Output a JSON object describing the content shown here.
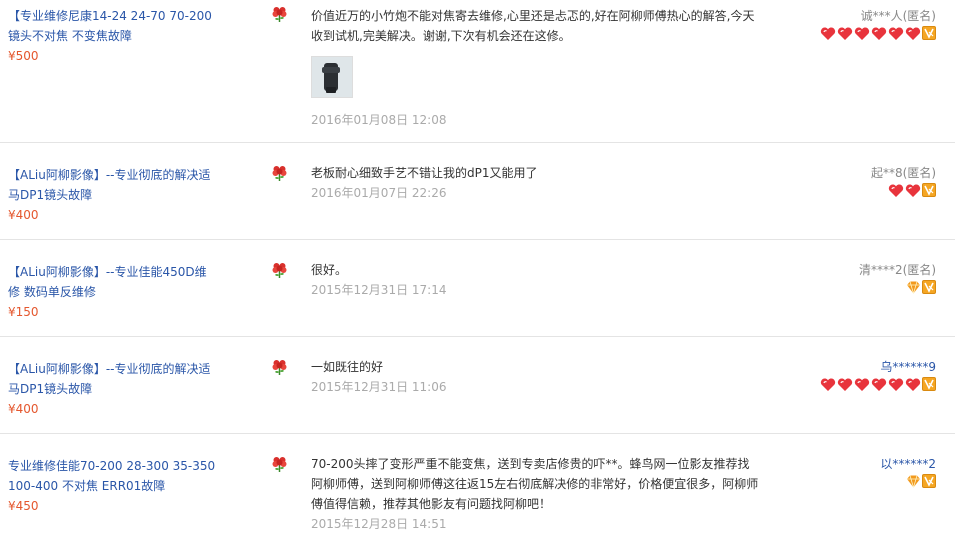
{
  "reviews": [
    {
      "product_title": "【专业维修尼康14-24 24-70 70-200镜头不对焦 不变焦故障",
      "price": "¥500",
      "text": "价值近万的小竹炮不能对焦寄去维修,心里还是忐忑的,好在阿柳师傅热心的解答,今天收到试机,完美解决。谢谢,下次有机会还在这修。",
      "date": "2016年01月08日 12:08",
      "user": "诚***人(匿名)",
      "user_style": "gray",
      "rating": {
        "icon": "heart-icon",
        "count": 6
      }
    },
    {
      "product_title": "【ALiu阿柳影像】--专业彻底的解决适马DP1镜头故障",
      "price": "¥400",
      "text": "老板耐心细致手艺不错让我的dP1又能用了",
      "date": "2016年01月07日 22:26",
      "user": "起**8(匿名)",
      "user_style": "gray",
      "rating": {
        "icon": "heart-icon",
        "count": 2
      }
    },
    {
      "product_title": "【ALiu阿柳影像】--专业佳能450D维修 数码单反维修",
      "price": "¥150",
      "text": "很好。",
      "date": "2015年12月31日 17:14",
      "user": "清****2(匿名)",
      "user_style": "gray",
      "rating": {
        "icon": "diamond-icon",
        "count": 1
      }
    },
    {
      "product_title": "【ALiu阿柳影像】--专业彻底的解决适马DP1镜头故障",
      "price": "¥400",
      "text": "一如既往的好",
      "date": "2015年12月31日 11:06",
      "user": "乌******9",
      "user_style": "blue",
      "rating": {
        "icon": "heart-icon",
        "count": 6
      }
    },
    {
      "product_title": "专业维修佳能70-200 28-300 35-350 100-400 不对焦 ERR01故障",
      "price": "¥450",
      "text": "70-200头摔了变形严重不能变焦，送到专卖店修贵的吓**。蜂鸟网一位影友推荐找阿柳师傅，送到阿柳师傅这往返15左右彻底解决修的非常好，价格便宜很多，阿柳师傅值得信赖，推荐其他影友有问题找阿柳吧！",
      "date": "2015年12月28日 14:51",
      "user": "以******2",
      "user_style": "blue",
      "rating": {
        "icon": "diamond-icon",
        "count": 1
      }
    }
  ],
  "colors": {
    "link": "#2a56a8",
    "price": "#e4572e",
    "date": "#aaaaaa",
    "heart": "#e8343c",
    "diamond": "#f29a1e",
    "vip": "#f5a623"
  }
}
